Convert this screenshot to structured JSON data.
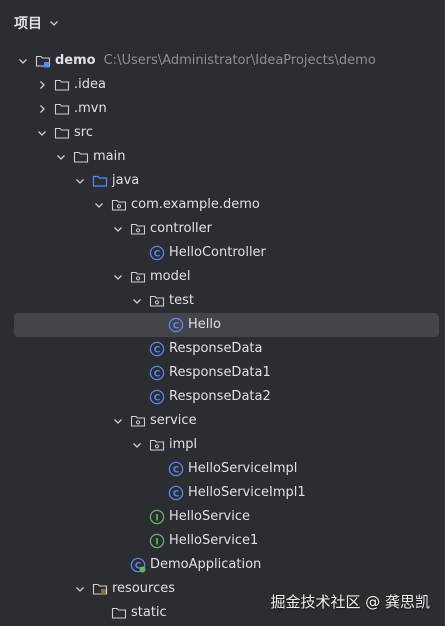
{
  "panel": {
    "title": "项目"
  },
  "tree": [
    {
      "label": "demo",
      "path": "C:\\Users\\Administrator\\IdeaProjects\\demo",
      "icon": "module-folder-icon",
      "arrow": "down"
    },
    {
      "label": ".idea",
      "icon": "folder-icon",
      "arrow": "right"
    },
    {
      "label": ".mvn",
      "icon": "folder-icon",
      "arrow": "right"
    },
    {
      "label": "src",
      "icon": "folder-icon",
      "arrow": "down"
    },
    {
      "label": "main",
      "icon": "folder-icon",
      "arrow": "down"
    },
    {
      "label": "java",
      "icon": "source-folder-icon",
      "arrow": "down"
    },
    {
      "label": "com.example.demo",
      "icon": "package-icon",
      "arrow": "down"
    },
    {
      "label": "controller",
      "icon": "package-icon",
      "arrow": "down"
    },
    {
      "label": "HelloController",
      "icon": "class-icon"
    },
    {
      "label": "model",
      "icon": "package-icon",
      "arrow": "down"
    },
    {
      "label": "test",
      "icon": "package-icon",
      "arrow": "down"
    },
    {
      "label": "Hello",
      "icon": "class-icon",
      "selected": true
    },
    {
      "label": "ResponseData",
      "icon": "class-icon"
    },
    {
      "label": "ResponseData1",
      "icon": "class-icon"
    },
    {
      "label": "ResponseData2",
      "icon": "class-icon"
    },
    {
      "label": "service",
      "icon": "package-icon",
      "arrow": "down"
    },
    {
      "label": "impl",
      "icon": "package-icon",
      "arrow": "down"
    },
    {
      "label": "HelloServiceImpl",
      "icon": "class-icon"
    },
    {
      "label": "HelloServiceImpl1",
      "icon": "class-icon"
    },
    {
      "label": "HelloService",
      "icon": "interface-icon"
    },
    {
      "label": "HelloService1",
      "icon": "interface-icon"
    },
    {
      "label": "DemoApplication",
      "icon": "spring-boot-class-icon"
    },
    {
      "label": "resources",
      "icon": "resources-folder-icon",
      "arrow": "down"
    },
    {
      "label": "static",
      "icon": "folder-icon"
    }
  ],
  "watermark": "掘金技术社区 @ 龚思凯",
  "colors": {
    "background": "#2b2d30",
    "selection": "#43454a",
    "text": "#dfe1e5",
    "path": "#8c8f94",
    "class_icon": "#548af7",
    "interface_icon": "#5fb865",
    "folder_outline": "#ced0d6",
    "source_folder": "#548af7"
  }
}
